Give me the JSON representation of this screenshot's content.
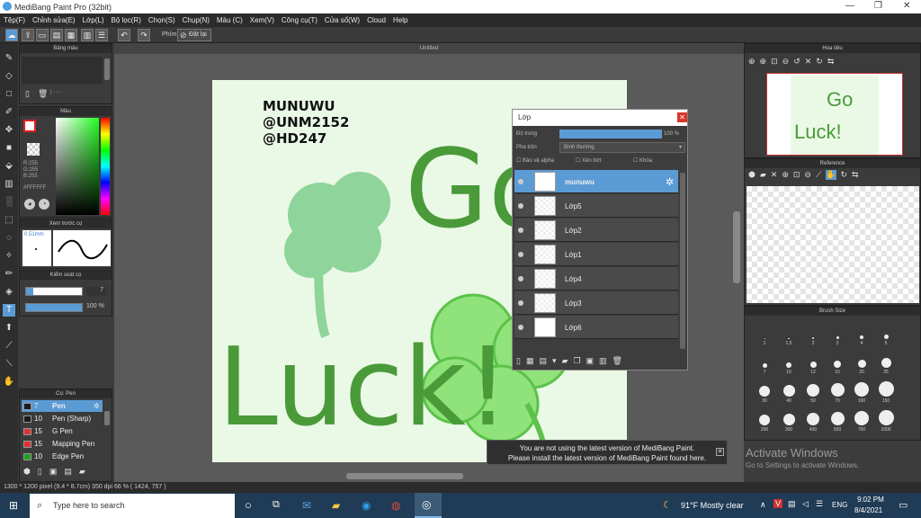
{
  "window": {
    "title": "MediBang Paint Pro (32bit)"
  },
  "menu": [
    "Tệp(F)",
    "Chỉnh sửa(E)",
    "Lớp(L)",
    "Bộ lọc(R)",
    "Chọn(S)",
    "Chụp(N)",
    "Màu (C)",
    "Xem(V)",
    "Công cụ(T)",
    "Cửa sổ(W)",
    "Cloud",
    "Help"
  ],
  "toolbar": {
    "phim_label": "Phím",
    "reset_label": "Đặt lại"
  },
  "panels": {
    "palette": "Bảng màu",
    "color": "Màu",
    "color_values": {
      "r": "R:255",
      "g": "G:255",
      "b": "B:255",
      "hex": "#FFFFFF"
    },
    "preview": "Xem trước cọ",
    "preview_size": "0.51mm",
    "brush_control": "Kiểm soát cọ",
    "brush_size_value": "7",
    "brush_opacity": "100 %",
    "brush_list": "Cọ: Pen",
    "navigator": "Hoa tiêu",
    "reference": "Reference",
    "brush_size": "Brush Size"
  },
  "brushes": [
    {
      "size": "7",
      "name": "Pen",
      "color": "#1a1a1a",
      "active": true
    },
    {
      "size": "10",
      "name": "Pen (Sharp)",
      "color": "#1a1a1a",
      "active": false
    },
    {
      "size": "15",
      "name": "G Pen",
      "color": "#e03030",
      "active": false
    },
    {
      "size": "15",
      "name": "Mapping Pen",
      "color": "#e03030",
      "active": false
    },
    {
      "size": "10",
      "name": "Edge Pen",
      "color": "#20a020",
      "active": false
    }
  ],
  "document": {
    "tab": "Untitled",
    "credit_lines": [
      "MUNUWU",
      "@UNM2152",
      "@HD247"
    ],
    "art_words": [
      "Go",
      "Luck!"
    ]
  },
  "layer_window": {
    "title": "Lớp",
    "opacity_label": "Độ trong",
    "opacity_value": "100 %",
    "blend_label": "Pha trộn",
    "blend_value": "Bình thường",
    "protect_alpha": "Bảo vệ alpha",
    "clip": "Xén bớt",
    "lock": "Khóa",
    "layers": [
      "munuwu",
      "Lớp5",
      "Lớp2",
      "Lớp1",
      "Lớp4",
      "Lớp3",
      "Lớp6"
    ]
  },
  "notice": {
    "line1": "You are not using the latest version of MediBang Paint.",
    "line2": "Please install the latest version of MediBang Paint found here."
  },
  "watermark": {
    "line1": "Activate Windows",
    "line2": "Go to Settings to activate Windows."
  },
  "brush_size_labels": [
    "1",
    "1.5",
    "2",
    "3",
    "4",
    "5",
    "7",
    "10",
    "12",
    "15",
    "20",
    "25",
    "30",
    "40",
    "50",
    "70",
    "100",
    "150",
    "200",
    "300",
    "400",
    "500",
    "700",
    "1000"
  ],
  "status": {
    "text": "1300 * 1200 pixel  (9.4 * 8.7cm)  350 dpi  66 %  ( 1424, 757 )"
  },
  "taskbar": {
    "search_placeholder": "Type here to search",
    "weather": "91°F  Mostly clear",
    "lang": "ENG",
    "time": "9:02 PM",
    "date": "8/4/2021"
  },
  "colors": {
    "accent": "#5b9bd5",
    "green_dark": "#4a9a3a",
    "green_light": "#8fe37a"
  }
}
